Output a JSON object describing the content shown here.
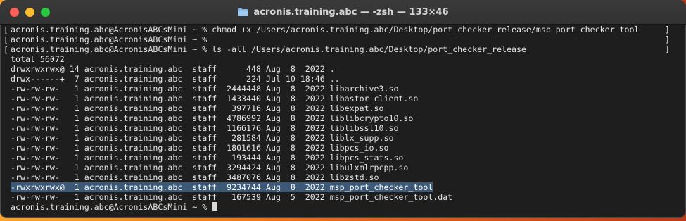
{
  "window": {
    "title": "acronis.training.abc — -zsh — 133×46"
  },
  "terminal": {
    "lines": [
      {
        "mark": "[",
        "text": "acronis.training.abc@AcronisABCsMini ~ % chmod +x /Users/acronis.training.abc/Desktop/port_checker_release/msp_port_checker_tool",
        "rb": "]"
      },
      {
        "mark": "[",
        "text": "acronis.training.abc@AcronisABCsMini ~ % ",
        "rb": "]"
      },
      {
        "mark": "[",
        "text": "acronis.training.abc@AcronisABCsMini ~ % ls -all /Users/acronis.training.abc/Desktop/port_checker_release",
        "rb": "]"
      },
      {
        "mark": "",
        "text": "total 56072",
        "rb": ""
      },
      {
        "mark": "",
        "text": "drwxrwxrwx@ 14 acronis.training.abc  staff      448 Aug  8  2022 .",
        "rb": ""
      },
      {
        "mark": "",
        "text": "drwx------+  7 acronis.training.abc  staff      224 Jul 10 18:46 ..",
        "rb": ""
      },
      {
        "mark": "",
        "text": "-rw-rw-rw-   1 acronis.training.abc  staff  2444448 Aug  8  2022 libarchive3.so",
        "rb": ""
      },
      {
        "mark": "",
        "text": "-rw-rw-rw-   1 acronis.training.abc  staff  1433440 Aug  8  2022 libastor_client.so",
        "rb": ""
      },
      {
        "mark": "",
        "text": "-rw-rw-rw-   1 acronis.training.abc  staff   397716 Aug  8  2022 libexpat.so",
        "rb": ""
      },
      {
        "mark": "",
        "text": "-rw-rw-rw-   1 acronis.training.abc  staff  4786992 Aug  8  2022 liblibcrypto10.so",
        "rb": ""
      },
      {
        "mark": "",
        "text": "-rw-rw-rw-   1 acronis.training.abc  staff  1166176 Aug  8  2022 liblibssl10.so",
        "rb": ""
      },
      {
        "mark": "",
        "text": "-rw-rw-rw-   1 acronis.training.abc  staff   281584 Aug  8  2022 liblx_supp.so",
        "rb": ""
      },
      {
        "mark": "",
        "text": "-rw-rw-rw-   1 acronis.training.abc  staff  1801616 Aug  8  2022 libpcs_io.so",
        "rb": ""
      },
      {
        "mark": "",
        "text": "-rw-rw-rw-   1 acronis.training.abc  staff   193444 Aug  8  2022 libpcs_stats.so",
        "rb": ""
      },
      {
        "mark": "",
        "text": "-rw-rw-rw-   1 acronis.training.abc  staff  3294424 Aug  8  2022 libulxmlrpcpp.so",
        "rb": ""
      },
      {
        "mark": "",
        "text": "-rw-rw-rw-   1 acronis.training.abc  staff  3487076 Aug  8  2022 libzstd.so",
        "rb": ""
      },
      {
        "mark": "",
        "text": "-rwxrwxrwx@  1 acronis.training.abc  staff  9234744 Aug  8  2022 msp_port_checker_tool",
        "rb": "",
        "highlight": true
      },
      {
        "mark": "",
        "text": "-rw-rw-rw-   1 acronis.training.abc  staff   167539 Aug  5  2022 msp_port_checker_tool.dat",
        "rb": ""
      },
      {
        "mark": "",
        "text": "acronis.training.abc@AcronisABCsMini ~ % ",
        "rb": "",
        "cursor": true
      }
    ]
  },
  "colors": {
    "close": "#fe5f57",
    "minimize": "#febc2e",
    "maximize": "#28c840",
    "selection": "#3c5a78"
  },
  "icons": {
    "title_icon": "folder-icon"
  }
}
